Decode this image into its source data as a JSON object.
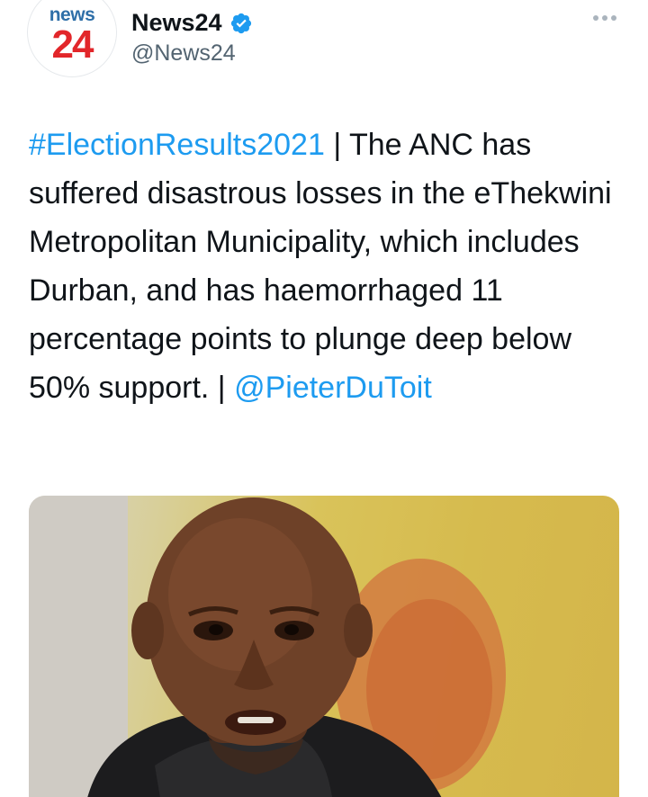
{
  "account": {
    "avatar_top": "news",
    "avatar_bottom": "24",
    "display_name": "News24",
    "handle": "@News24",
    "verified_icon": "verified-badge-icon",
    "more_icon": "more-options-icon"
  },
  "tweet": {
    "hashtag": "#ElectionResults2021",
    "body": " | The ANC has suffered disastrous losses in the eThekwini Metropolitan Municipality, which includes Durban, and has haemorrhaged 11 percentage points to plunge deep below 50% support. | ",
    "mention": "@PieterDuToit"
  },
  "media": {
    "colors": {
      "background": "#d6bb4e",
      "accent_link": "#1d9bf0"
    }
  }
}
